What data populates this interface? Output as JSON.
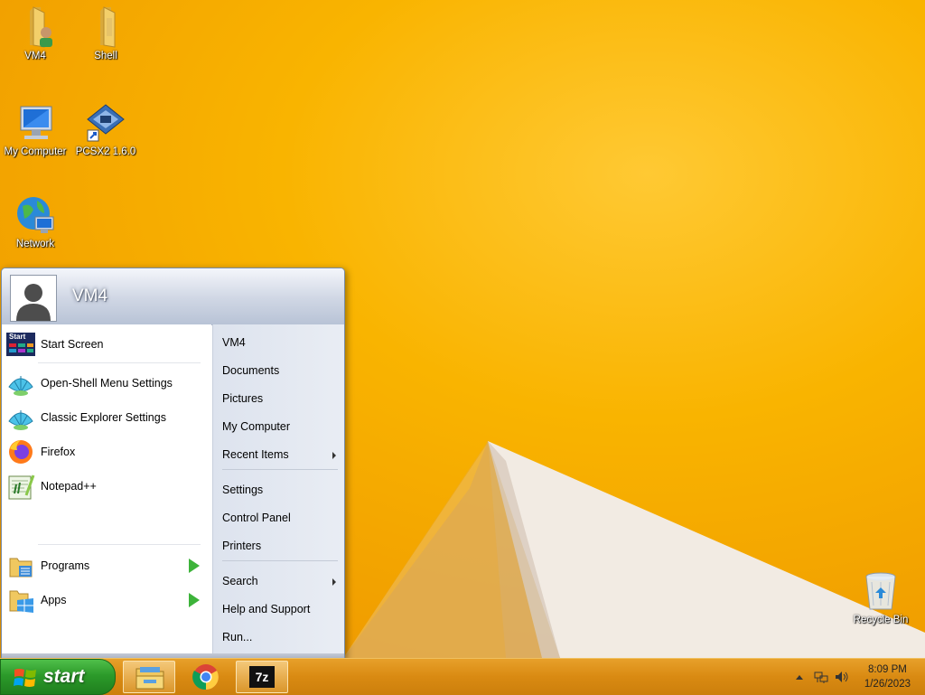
{
  "desktop": {
    "icons": [
      {
        "label": "VM4",
        "icon": "user-folder-icon"
      },
      {
        "label": "Shell",
        "icon": "folder-icon"
      },
      {
        "label": "My Computer",
        "icon": "computer-icon"
      },
      {
        "label": "PCSX2 1.6.0",
        "icon": "pcsx2-shortcut-icon"
      },
      {
        "label": "Network",
        "icon": "network-globe-icon"
      },
      {
        "label": "Recycle Bin",
        "icon": "recycle-bin-icon"
      }
    ]
  },
  "start_menu": {
    "user_name": "VM4",
    "left_items": [
      {
        "label": "Start Screen",
        "icon": "start-screen-icon"
      },
      {
        "label": "Open-Shell Menu Settings",
        "icon": "shell-icon"
      },
      {
        "label": "Classic Explorer Settings",
        "icon": "shell-icon"
      },
      {
        "label": "Firefox",
        "icon": "firefox-icon"
      },
      {
        "label": "Notepad++",
        "icon": "notepad-plus-plus-icon"
      }
    ],
    "start_screen_icon_text": "Start",
    "programs_label": "Programs",
    "apps_label": "Apps",
    "search_placeholder": "Search",
    "right_items": [
      {
        "label": "VM4"
      },
      {
        "label": "Documents"
      },
      {
        "label": "Pictures"
      },
      {
        "label": "My Computer"
      },
      {
        "label": "Recent Items",
        "submenu": true
      },
      {
        "label": "Settings"
      },
      {
        "label": "Control Panel"
      },
      {
        "label": "Printers"
      },
      {
        "label": "Search",
        "submenu": true
      },
      {
        "label": "Help and Support"
      },
      {
        "label": "Run..."
      }
    ]
  },
  "taskbar": {
    "start_label": "start",
    "pinned": [
      {
        "name": "file-explorer",
        "icon": "file-explorer-icon",
        "active": true
      },
      {
        "name": "chrome",
        "icon": "chrome-icon",
        "active": false
      },
      {
        "name": "7zip",
        "icon": "seven-zip-icon",
        "label": "7z",
        "active": true
      }
    ],
    "time": "8:09 PM",
    "date": "1/26/2023"
  },
  "colors": {
    "desktop_bg": "#f5b000",
    "start_green": "#2c9a2a",
    "taskbar": "#d98a12"
  }
}
